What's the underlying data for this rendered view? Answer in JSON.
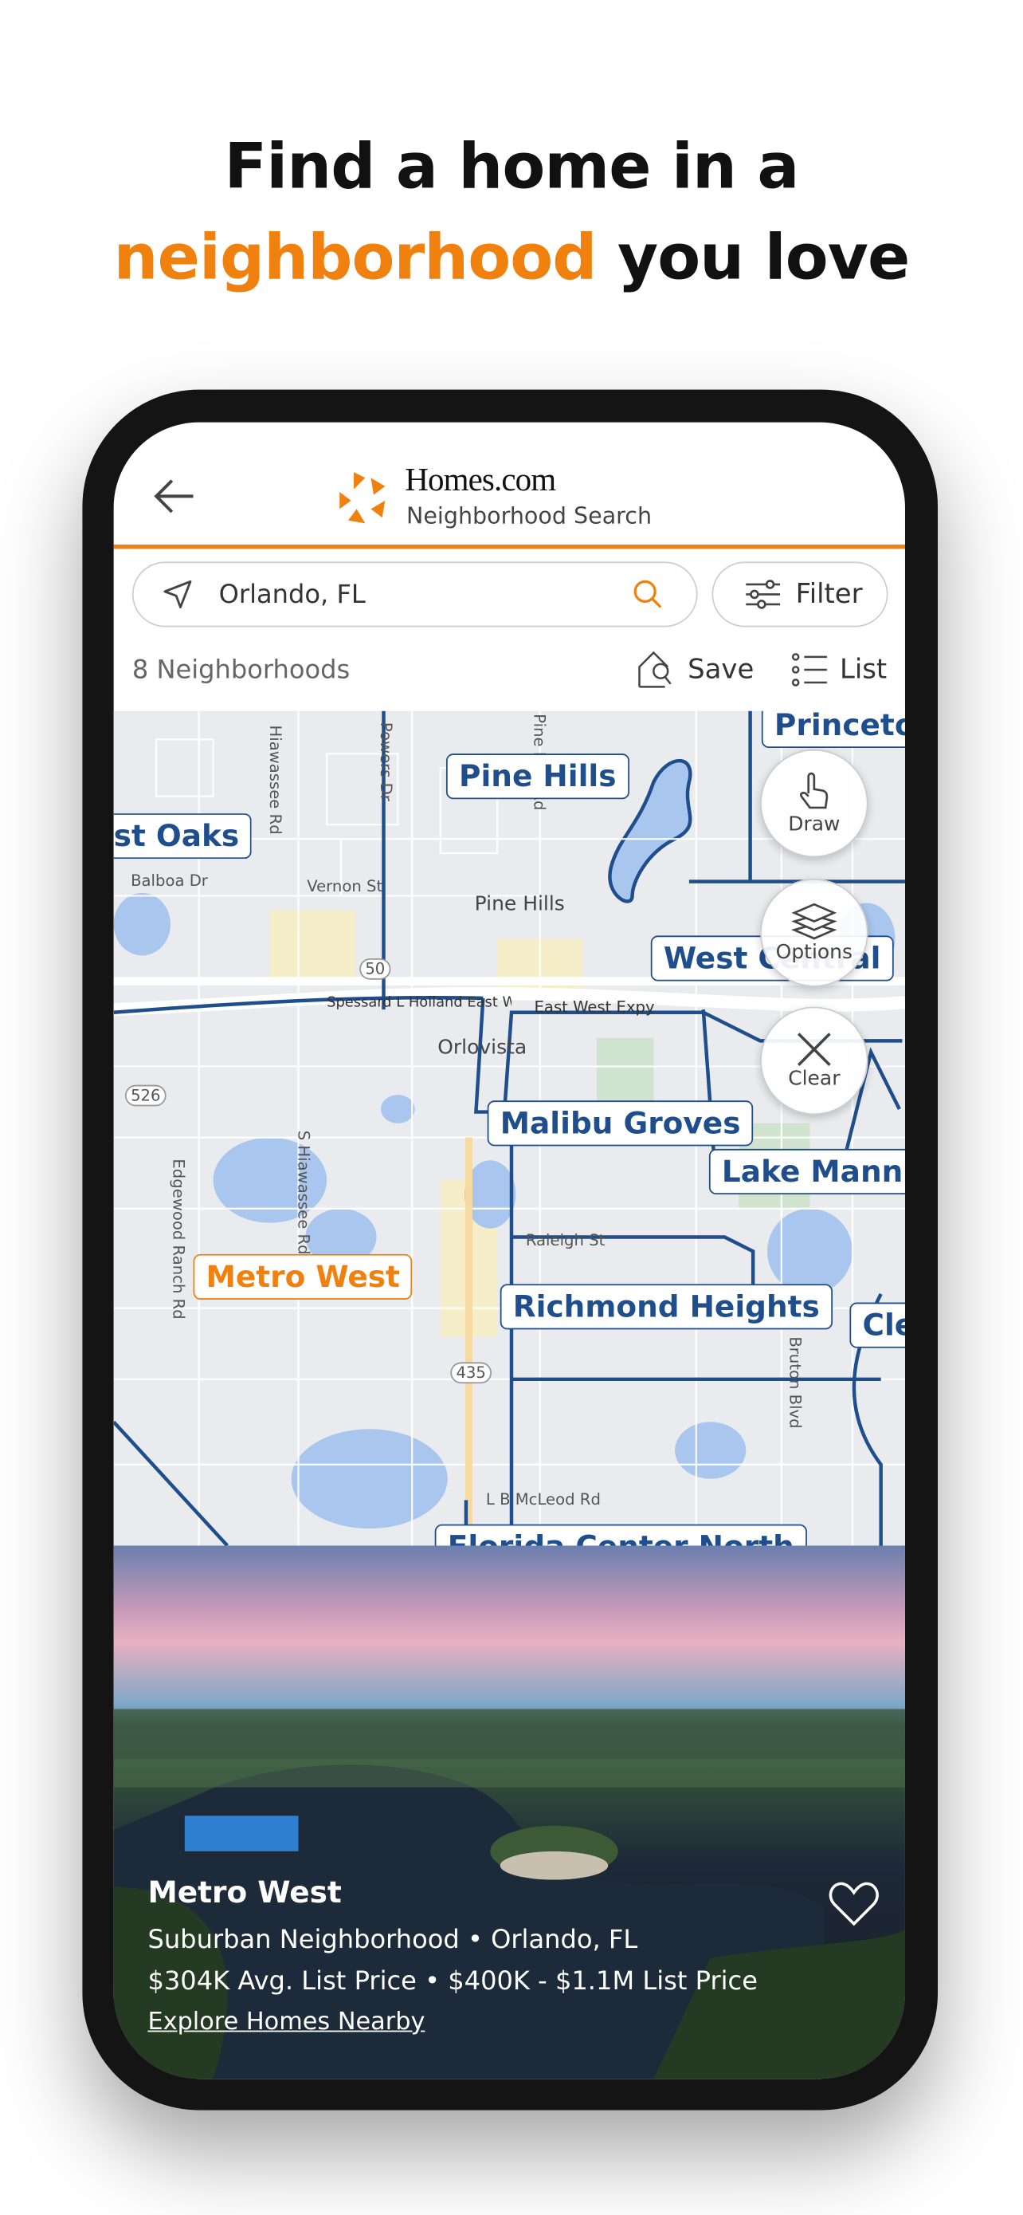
{
  "headline": {
    "line1": "Find a home in a",
    "line2_highlight": "neighborhood",
    "line2_rest": " you love"
  },
  "colors": {
    "brand_orange": "#f0810f",
    "map_blue": "#1f4e8c"
  },
  "header": {
    "back_icon": "arrow-left-icon",
    "brand": "Homes.com",
    "subtitle": "Neighborhood Search"
  },
  "search": {
    "value": "Orlando, FL",
    "location_icon": "location-arrow-icon",
    "search_icon": "search-icon"
  },
  "filter": {
    "label": "Filter",
    "icon": "sliders-icon"
  },
  "results": {
    "count": "8 Neighborhoods",
    "save_label": "Save",
    "list_label": "List"
  },
  "map": {
    "neighborhoods": [
      {
        "label": "Pine Hills"
      },
      {
        "label": "st Oaks"
      },
      {
        "label": "Princeton"
      },
      {
        "label": "West Central"
      },
      {
        "label": "Malibu Groves"
      },
      {
        "label": "Lake Mann"
      },
      {
        "label": "Metro West",
        "selected": true
      },
      {
        "label": "Richmond Heights"
      },
      {
        "label": "Cle"
      },
      {
        "label": "Florida Center North"
      }
    ],
    "streets": [
      "Balboa Dr",
      "Vernon St",
      "Pine Hills",
      "Orlovista",
      "Hiawassee Rd",
      "Powers Dr",
      "Pine Hills Rd",
      "East West Expy",
      "Spessard L Holland East West Expy",
      "Edgewood Ranch Rd",
      "S Hiawassee Rd",
      "Raleigh St",
      "L B McLeod Rd",
      "Bruton Blvd",
      "50",
      "526",
      "435"
    ],
    "controls": [
      {
        "label": "Draw",
        "icon": "hand-pointer-icon"
      },
      {
        "label": "Options",
        "icon": "layers-icon"
      },
      {
        "label": "Clear",
        "icon": "close-icon"
      }
    ]
  },
  "card": {
    "title": "Metro West",
    "type_location": "Suburban Neighborhood  •  Orlando, FL",
    "prices": "$304K Avg. List Price  •  $400K - $1.1M List Price",
    "link": "Explore Homes Nearby",
    "favorite_icon": "heart-icon"
  }
}
